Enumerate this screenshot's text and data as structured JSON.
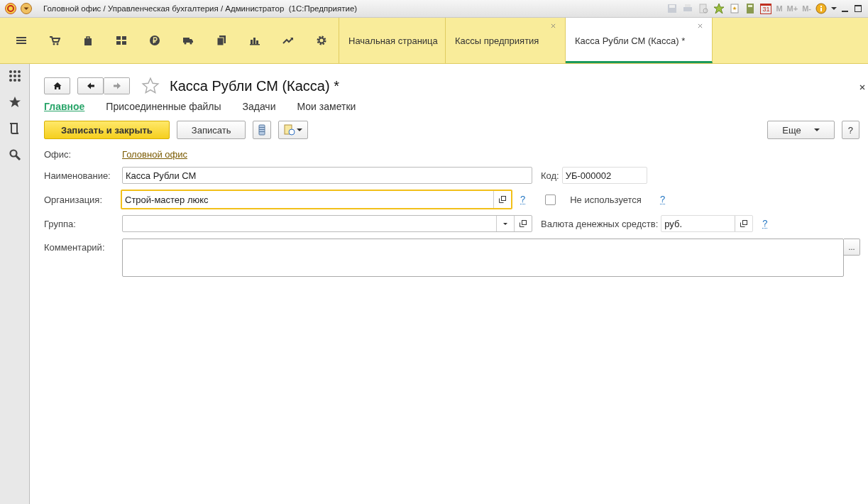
{
  "window": {
    "title": "Головной офис / Управленческая бухгалтерия / Администратор  (1С:Предприятие)",
    "calendar_day": "31",
    "memory_buttons": [
      "M",
      "M+",
      "M-"
    ]
  },
  "tabs": [
    {
      "label": "Начальная страница",
      "selected": false,
      "closable": false
    },
    {
      "label": "Кассы предприятия",
      "selected": false,
      "closable": true
    },
    {
      "label": "Касса Рубли СМ (Касса) *",
      "selected": true,
      "closable": true
    }
  ],
  "form": {
    "title": "Касса Рубли СМ (Касса) *",
    "favorite": false,
    "sections": [
      {
        "label": "Главное",
        "selected": true
      },
      {
        "label": "Присоединенные файлы",
        "selected": false
      },
      {
        "label": "Задачи",
        "selected": false
      },
      {
        "label": "Мои заметки",
        "selected": false
      }
    ],
    "commands": {
      "primary": "Записать и закрыть",
      "save": "Записать",
      "more": "Еще",
      "help": "?"
    },
    "office": {
      "label": "Офис:",
      "value": "Головной офис"
    },
    "name": {
      "label": "Наименование:",
      "value": "Касса Рубли СМ"
    },
    "code": {
      "label": "Код:",
      "value": "УБ-000002"
    },
    "organization": {
      "label": "Организация:",
      "value": "Строй-мастер люкс",
      "focused": true,
      "help": "?"
    },
    "not_used": {
      "label": "Не используется",
      "checked": false,
      "help": "?"
    },
    "group": {
      "label": "Группа:"
    },
    "currency": {
      "label": "Валюта денежных средств:",
      "value": "руб.",
      "help": "?"
    },
    "comment": {
      "label": "Комментарий:",
      "more": "..."
    }
  }
}
